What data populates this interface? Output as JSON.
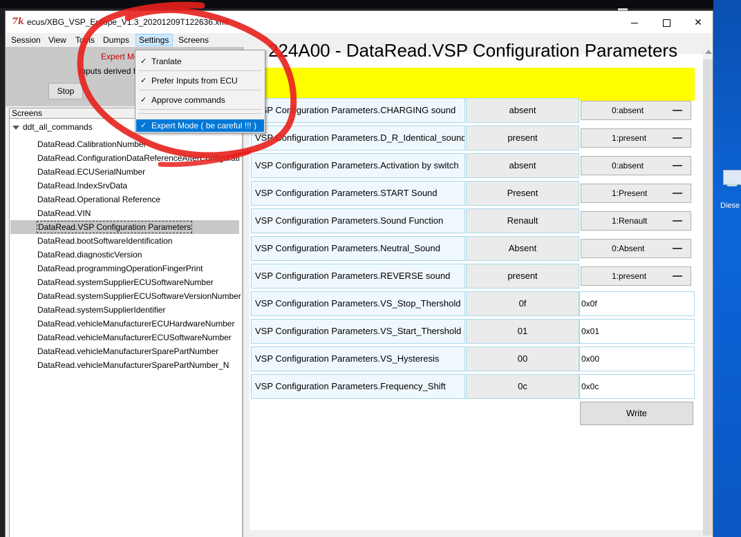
{
  "window": {
    "title": "ecus/XBG_VSP_Europe_V1.3_20201209T122636.xml",
    "app_icon": "tk-feather-icon"
  },
  "menu": {
    "items": [
      "Session",
      "View",
      "Tools",
      "Dumps",
      "Settings",
      "Screens"
    ],
    "active": "Settings"
  },
  "settings_menu": {
    "items": [
      {
        "label": "Tranlate",
        "checked": true
      },
      {
        "label": "Prefer Inputs from ECU",
        "checked": true
      },
      {
        "label": "Approve commands",
        "checked": true
      },
      {
        "label": "Expert Mode ( be careful !!! )",
        "checked": true
      }
    ],
    "check_glyph": "✓"
  },
  "left": {
    "expert_label": "Expert Mo",
    "inputs_label": "Inputs derived f",
    "stop_label": "Stop",
    "screens_header": "Screens",
    "tree_root": "ddt_all_commands",
    "tree_items": [
      "DataRead.CalibrationNumber",
      "DataRead.ConfigurationDataReferenceAfterConfigurati",
      "DataRead.ECUSerialNumber",
      "DataRead.IndexSrvData",
      "DataRead.Operational Reference",
      "DataRead.VIN",
      "DataRead.VSP Configuration Parameters",
      "DataRead.bootSoftwareIdentification",
      "DataRead.diagnosticVersion",
      "DataRead.programmingOperationFingerPrint",
      "DataRead.systemSupplierECUSoftwareNumber",
      "DataRead.systemSupplierECUSoftwareVersionNumber",
      "DataRead.systemSupplierIdentifier",
      "DataRead.vehicleManufacturerECUHardwareNumber",
      "DataRead.vehicleManufacturerECUSoftwareNumber",
      "DataRead.vehicleManufacturerSparePartNumber",
      "DataRead.vehicleManufacturerSparePartNumber_N"
    ],
    "selected_index": 6
  },
  "right": {
    "header": "224A00 - DataRead.VSP Configuration Parameters",
    "rows": [
      {
        "name": "VSP Configuration Parameters.CHARGING sound",
        "value": "absent",
        "select": "0:absent"
      },
      {
        "name": "VSP Configuration Parameters.D_R_Identical_sound",
        "value": "present",
        "select": "1:present"
      },
      {
        "name": "VSP Configuration Parameters.Activation by switch",
        "value": "absent",
        "select": "0:absent"
      },
      {
        "name": "VSP Configuration Parameters.START Sound",
        "value": "Present",
        "select": "1:Present"
      },
      {
        "name": "VSP Configuration Parameters.Sound Function",
        "value": "Renault",
        "select": "1:Renault"
      },
      {
        "name": "VSP Configuration Parameters.Neutral_Sound",
        "value": "Absent",
        "select": "0:Absent"
      },
      {
        "name": "VSP Configuration Parameters.REVERSE sound",
        "value": "present",
        "select": "1:present"
      },
      {
        "name": "VSP Configuration Parameters.VS_Stop_Thershold",
        "value": "0f",
        "input": "0x0f"
      },
      {
        "name": "VSP Configuration Parameters.VS_Start_Thershold",
        "value": "01",
        "input": "0x01"
      },
      {
        "name": "VSP Configuration Parameters.VS_Hysteresis",
        "value": "00",
        "input": "0x00"
      },
      {
        "name": "VSP Configuration Parameters.Frequency_Shift",
        "value": "0c",
        "input": "0x0c"
      }
    ],
    "write_label": "Write"
  },
  "desktop": {
    "icon_label": "Diese"
  },
  "colors": {
    "header_bg": "#ffff00",
    "highlight": "#0078d7",
    "annotation": "#e8201c"
  }
}
